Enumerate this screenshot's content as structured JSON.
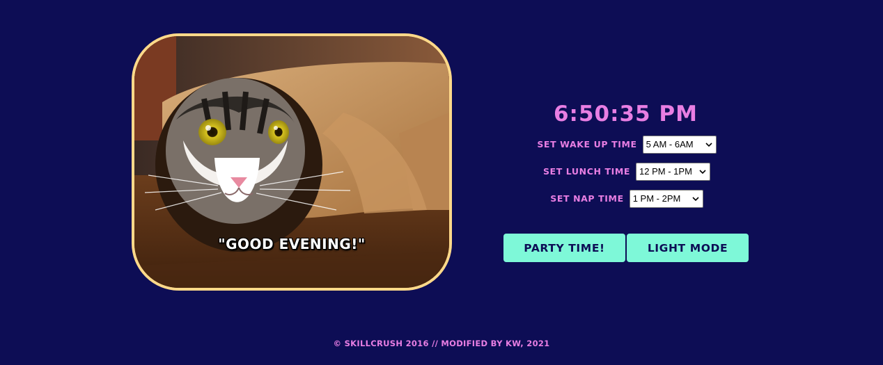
{
  "page": {
    "background_color": "#0d0d55",
    "accent_color": "#e87ee3",
    "button_color": "#7ef8d8",
    "frame_color": "#ffd98a"
  },
  "photo": {
    "subject": "cat wrapped in brown paper on a wooden floor",
    "caption": "\"GOOD EVENING!\""
  },
  "clock": {
    "time": "6:50:35 PM"
  },
  "settings": [
    {
      "label": "Set Wake Up Time",
      "selected": "5 AM - 6AM"
    },
    {
      "label": "Set Lunch Time",
      "selected": "12 PM - 1PM"
    },
    {
      "label": "Set Nap Time",
      "selected": "1 PM - 2PM"
    }
  ],
  "buttons": {
    "party": "Party Time!",
    "light_mode": "Light Mode"
  },
  "footer": {
    "text": "© Skillcrush 2016 // Modified by KW, 2021"
  }
}
